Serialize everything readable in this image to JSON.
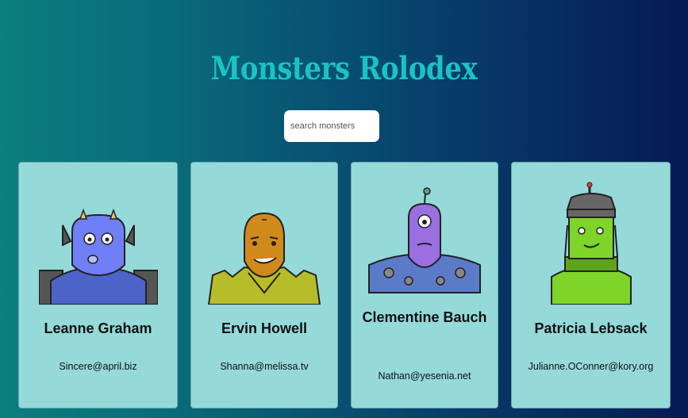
{
  "app": {
    "title": "Monsters Rolodex"
  },
  "search": {
    "placeholder": "search monsters",
    "value": ""
  },
  "monsters": [
    {
      "name": "Leanne Graham",
      "email": "Sincere@april.biz",
      "skin": "#6f7ff5"
    },
    {
      "name": "Ervin Howell",
      "email": "Shanna@melissa.tv",
      "skin": "#d08a1c"
    },
    {
      "name": "Clementine Bauch",
      "email": "Nathan@yesenia.net",
      "skin": "#9a6fe0"
    },
    {
      "name": "Patricia Lebsack",
      "email": "Julianne.OConner@kory.org",
      "skin": "#7fd42a"
    }
  ],
  "colors": {
    "title": "#19c3c5",
    "card_background": "#95d9d9",
    "gradient_start": "#0b7e7f",
    "gradient_end": "#061a55"
  }
}
